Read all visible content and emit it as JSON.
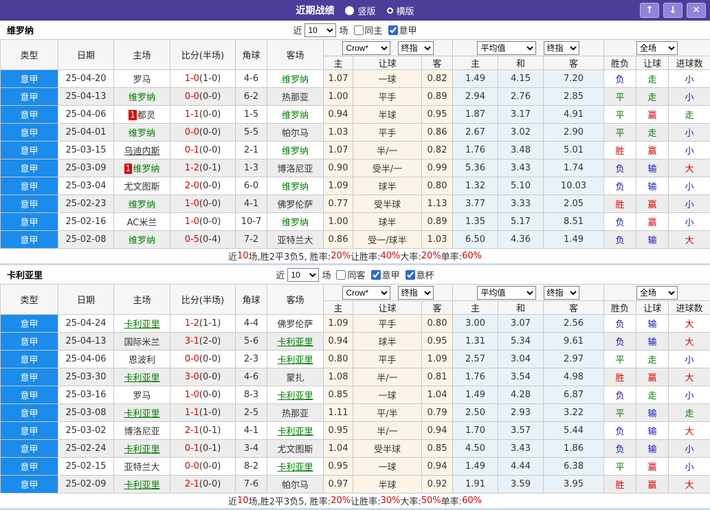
{
  "titlebar": {
    "title": "近期战绩",
    "vertical": "竖版",
    "horizontal": "横版",
    "up": "↑",
    "down": "↓",
    "close": "✕"
  },
  "columns": {
    "type": "类型",
    "date": "日期",
    "home": "主场",
    "score": "比分(半场)",
    "corner": "角球",
    "away": "客场",
    "crow": "Crow*",
    "final1": "终指",
    "avg": "平均值",
    "final2": "终指",
    "full": "全场",
    "sub": [
      "主",
      "让球",
      "客",
      "主",
      "和",
      "客",
      "胜负",
      "让球",
      "进球数"
    ]
  },
  "sections": [
    {
      "team": "维罗纳",
      "controls": {
        "near": "近",
        "count": "10",
        "games": "场",
        "checkboxes": [
          {
            "label": "同主",
            "checked": false
          },
          {
            "label": "意甲",
            "checked": true
          }
        ]
      },
      "rows": [
        {
          "lg": "意甲",
          "dt": "25-04-20",
          "h": {
            "n": "罗马"
          },
          "ft": "1-0",
          "ht": "(1-0)",
          "cn": "4-6",
          "a": {
            "n": "维罗纳",
            "g": 1
          },
          "o": [
            "1.07",
            "一球",
            "0.82"
          ],
          "v": [
            "1.49",
            "4.15",
            "7.20"
          ],
          "r": [
            "负",
            "走",
            "小"
          ]
        },
        {
          "lg": "意甲",
          "dt": "25-04-13",
          "h": {
            "n": "维罗纳",
            "g": 1
          },
          "ft": "0-0",
          "ht": "(0-0)",
          "cn": "6-2",
          "a": {
            "n": "热那亚"
          },
          "o": [
            "1.00",
            "平手",
            "0.89"
          ],
          "v": [
            "2.94",
            "2.76",
            "2.85"
          ],
          "r": [
            "平",
            "走",
            "小"
          ]
        },
        {
          "lg": "意甲",
          "dt": "25-04-06",
          "h": {
            "n": "都灵",
            "bd": "1"
          },
          "ft": "1-1",
          "ht": "(0-0)",
          "cn": "1-5",
          "a": {
            "n": "维罗纳",
            "g": 1
          },
          "o": [
            "0.94",
            "半球",
            "0.95"
          ],
          "v": [
            "1.87",
            "3.17",
            "4.91"
          ],
          "r": [
            "平",
            "赢",
            "走"
          ]
        },
        {
          "lg": "意甲",
          "dt": "25-04-01",
          "h": {
            "n": "维罗纳",
            "g": 1
          },
          "ft": "0-0",
          "ht": "(0-0)",
          "cn": "5-5",
          "a": {
            "n": "帕尔马"
          },
          "o": [
            "1.03",
            "平手",
            "0.86"
          ],
          "v": [
            "2.67",
            "3.02",
            "2.90"
          ],
          "r": [
            "平",
            "走",
            "小"
          ]
        },
        {
          "lg": "意甲",
          "dt": "25-03-15",
          "h": {
            "n": "乌迪内斯",
            "u": 1
          },
          "ft": "0-1",
          "ht": "(0-0)",
          "cn": "2-1",
          "a": {
            "n": "维罗纳",
            "g": 1
          },
          "o": [
            "1.07",
            "半/一",
            "0.82"
          ],
          "v": [
            "1.76",
            "3.48",
            "5.01"
          ],
          "r": [
            "胜",
            "赢",
            "小"
          ]
        },
        {
          "lg": "意甲",
          "dt": "25-03-09",
          "h": {
            "n": "维罗纳",
            "g": 1,
            "bd": "1"
          },
          "ft": "1-2",
          "ht": "(0-1)",
          "cn": "1-3",
          "a": {
            "n": "博洛尼亚"
          },
          "o": [
            "0.90",
            "受半/一",
            "0.99"
          ],
          "v": [
            "5.36",
            "3.43",
            "1.74"
          ],
          "r": [
            "负",
            "输",
            "大"
          ]
        },
        {
          "lg": "意甲",
          "dt": "25-03-04",
          "h": {
            "n": "尤文图斯"
          },
          "ft": "2-0",
          "ht": "(0-0)",
          "cn": "6-0",
          "a": {
            "n": "维罗纳",
            "g": 1
          },
          "o": [
            "1.09",
            "球半",
            "0.80"
          ],
          "v": [
            "1.32",
            "5.10",
            "10.03"
          ],
          "r": [
            "负",
            "输",
            "小"
          ]
        },
        {
          "lg": "意甲",
          "dt": "25-02-23",
          "h": {
            "n": "维罗纳",
            "g": 1
          },
          "ft": "1-0",
          "ht": "(0-0)",
          "cn": "4-1",
          "a": {
            "n": "佛罗伦萨"
          },
          "o": [
            "0.77",
            "受半球",
            "1.13"
          ],
          "v": [
            "3.77",
            "3.33",
            "2.05"
          ],
          "r": [
            "胜",
            "赢",
            "小"
          ]
        },
        {
          "lg": "意甲",
          "dt": "25-02-16",
          "h": {
            "n": "AC米兰"
          },
          "ft": "1-0",
          "ht": "(0-0)",
          "cn": "10-7",
          "a": {
            "n": "维罗纳",
            "g": 1
          },
          "o": [
            "1.00",
            "球半",
            "0.89"
          ],
          "v": [
            "1.35",
            "5.17",
            "8.51"
          ],
          "r": [
            "负",
            "赢",
            "小"
          ]
        },
        {
          "lg": "意甲",
          "dt": "25-02-08",
          "h": {
            "n": "维罗纳",
            "g": 1
          },
          "ft": "0-5",
          "ht": "(0-4)",
          "cn": "7-2",
          "a": {
            "n": "亚特兰大"
          },
          "o": [
            "0.86",
            "受一/球半",
            "1.03"
          ],
          "v": [
            "6.50",
            "4.36",
            "1.49"
          ],
          "r": [
            "负",
            "输",
            "大"
          ]
        }
      ],
      "summary": [
        {
          "t": "近"
        },
        {
          "t": "10",
          "red": true
        },
        {
          "t": "场,胜2平3负5, 胜率:"
        },
        {
          "t": "20%",
          "red": true
        },
        {
          "t": " 让胜率:"
        },
        {
          "t": "40%",
          "red": true
        },
        {
          "t": " 大率:"
        },
        {
          "t": "20%",
          "red": true
        },
        {
          "t": " 单率:"
        },
        {
          "t": "60%",
          "red": true
        }
      ]
    },
    {
      "team": "卡利亚里",
      "controls": {
        "near": "近",
        "count": "10",
        "games": "场",
        "checkboxes": [
          {
            "label": "同客",
            "checked": false
          },
          {
            "label": "意甲",
            "checked": true
          },
          {
            "label": "意杯",
            "checked": true
          }
        ]
      },
      "rows": [
        {
          "lg": "意甲",
          "dt": "25-04-24",
          "h": {
            "n": "卡利亚里",
            "g": 1,
            "u": 1
          },
          "ft": "1-2",
          "ht": "(1-1)",
          "cn": "4-4",
          "a": {
            "n": "佛罗伦萨"
          },
          "o": [
            "1.09",
            "平手",
            "0.80"
          ],
          "v": [
            "3.00",
            "3.07",
            "2.56"
          ],
          "r": [
            "负",
            "输",
            "大"
          ]
        },
        {
          "lg": "意甲",
          "dt": "25-04-13",
          "h": {
            "n": "国际米兰"
          },
          "ft": "3-1",
          "ht": "(2-0)",
          "cn": "5-6",
          "a": {
            "n": "卡利亚里",
            "g": 1,
            "u": 1
          },
          "o": [
            "0.94",
            "球半",
            "0.95"
          ],
          "v": [
            "1.31",
            "5.34",
            "9.61"
          ],
          "r": [
            "负",
            "输",
            "大"
          ]
        },
        {
          "lg": "意甲",
          "dt": "25-04-06",
          "h": {
            "n": "恩波利"
          },
          "ft": "0-0",
          "ht": "(0-0)",
          "cn": "2-3",
          "a": {
            "n": "卡利亚里",
            "g": 1,
            "u": 1
          },
          "o": [
            "0.80",
            "平手",
            "1.09"
          ],
          "v": [
            "2.57",
            "3.04",
            "2.97"
          ],
          "r": [
            "平",
            "走",
            "小"
          ]
        },
        {
          "lg": "意甲",
          "dt": "25-03-30",
          "h": {
            "n": "卡利亚里",
            "g": 1,
            "u": 1
          },
          "ft": "3-0",
          "ht": "(0-0)",
          "cn": "4-6",
          "a": {
            "n": "蒙扎"
          },
          "o": [
            "1.08",
            "半/一",
            "0.81"
          ],
          "v": [
            "1.76",
            "3.54",
            "4.98"
          ],
          "r": [
            "胜",
            "赢",
            "大"
          ]
        },
        {
          "lg": "意甲",
          "dt": "25-03-16",
          "h": {
            "n": "罗马"
          },
          "ft": "1-0",
          "ht": "(0-0)",
          "cn": "8-3",
          "a": {
            "n": "卡利亚里",
            "g": 1,
            "u": 1
          },
          "o": [
            "0.85",
            "一球",
            "1.04"
          ],
          "v": [
            "1.49",
            "4.28",
            "6.87"
          ],
          "r": [
            "负",
            "走",
            "小"
          ]
        },
        {
          "lg": "意甲",
          "dt": "25-03-08",
          "h": {
            "n": "卡利亚里",
            "g": 1,
            "u": 1
          },
          "ft": "1-1",
          "ht": "(1-0)",
          "cn": "2-5",
          "a": {
            "n": "热那亚"
          },
          "o": [
            "1.11",
            "平/半",
            "0.79"
          ],
          "v": [
            "2.50",
            "2.93",
            "3.22"
          ],
          "r": [
            "平",
            "输",
            "走"
          ]
        },
        {
          "lg": "意甲",
          "dt": "25-03-02",
          "h": {
            "n": "博洛尼亚"
          },
          "ft": "2-1",
          "ht": "(0-1)",
          "cn": "4-1",
          "a": {
            "n": "卡利亚里",
            "g": 1,
            "u": 1
          },
          "o": [
            "0.95",
            "半/一",
            "0.94"
          ],
          "v": [
            "1.70",
            "3.57",
            "5.44"
          ],
          "r": [
            "负",
            "输",
            "大"
          ]
        },
        {
          "lg": "意甲",
          "dt": "25-02-24",
          "h": {
            "n": "卡利亚里",
            "g": 1,
            "u": 1
          },
          "ft": "0-1",
          "ht": "(0-1)",
          "cn": "3-4",
          "a": {
            "n": "尤文图斯"
          },
          "o": [
            "1.04",
            "受半球",
            "0.85"
          ],
          "v": [
            "4.50",
            "3.43",
            "1.86"
          ],
          "r": [
            "负",
            "输",
            "小"
          ]
        },
        {
          "lg": "意甲",
          "dt": "25-02-15",
          "h": {
            "n": "亚特兰大"
          },
          "ft": "0-0",
          "ht": "(0-0)",
          "cn": "8-2",
          "a": {
            "n": "卡利亚里",
            "g": 1,
            "u": 1
          },
          "o": [
            "0.95",
            "一球",
            "0.94"
          ],
          "v": [
            "1.49",
            "4.44",
            "6.38"
          ],
          "r": [
            "平",
            "赢",
            "小"
          ]
        },
        {
          "lg": "意甲",
          "dt": "25-02-09",
          "h": {
            "n": "卡利亚里",
            "g": 1,
            "u": 1
          },
          "ft": "2-1",
          "ht": "(0-0)",
          "cn": "7-6",
          "a": {
            "n": "帕尔马"
          },
          "o": [
            "0.97",
            "半球",
            "0.92"
          ],
          "v": [
            "1.91",
            "3.59",
            "3.95"
          ],
          "r": [
            "胜",
            "赢",
            "大"
          ]
        }
      ],
      "summary": [
        {
          "t": "近"
        },
        {
          "t": "10",
          "red": true
        },
        {
          "t": "场,胜2平3负5, 胜率:"
        },
        {
          "t": "20%",
          "red": true
        },
        {
          "t": " 让胜率:"
        },
        {
          "t": "30%",
          "red": true
        },
        {
          "t": " 大率:"
        },
        {
          "t": "50%",
          "red": true
        },
        {
          "t": " 单率:"
        },
        {
          "t": "60%",
          "red": true
        }
      ]
    }
  ]
}
